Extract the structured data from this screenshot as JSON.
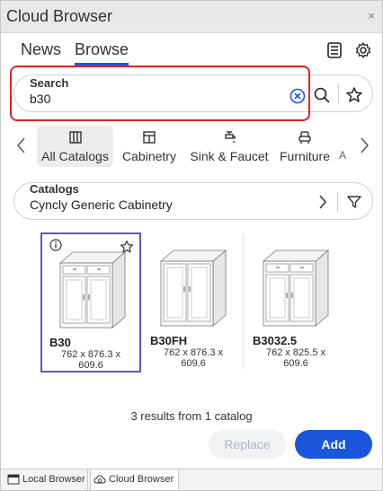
{
  "window": {
    "title": "Cloud Browser",
    "close_glyph": "×"
  },
  "tabs": [
    {
      "label": "News",
      "active": false
    },
    {
      "label": "Browse",
      "active": true
    }
  ],
  "header_icons": [
    "list-view-icon",
    "gear-icon"
  ],
  "search": {
    "label": "Search",
    "value": "b30",
    "icons": [
      "clear-icon",
      "search-icon",
      "star-icon"
    ]
  },
  "categories": [
    {
      "label": "All Catalogs",
      "icon": "catalog-book-icon",
      "active": true
    },
    {
      "label": "Cabinetry",
      "icon": "cabinet-icon",
      "active": false
    },
    {
      "label": "Sink & Faucet",
      "icon": "faucet-icon",
      "active": false
    },
    {
      "label": "Furniture",
      "icon": "armchair-icon",
      "active": false
    },
    {
      "label": "A",
      "icon": "",
      "active": false
    }
  ],
  "catalog": {
    "label": "Catalogs",
    "value": "Cyncly Generic Cabinetry",
    "icons": [
      "chevron-right-icon",
      "filter-icon"
    ]
  },
  "results": [
    {
      "name": "B30",
      "dims_line1": "762 x  876.3 x",
      "dims_line2": "609.6",
      "selected": true,
      "drawers": 2
    },
    {
      "name": "B30FH",
      "dims_line1": "762 x  876.3 x",
      "dims_line2": "609.6",
      "selected": false,
      "drawers": 0
    },
    {
      "name": "B3032.5",
      "dims_line1": "762 x  825.5 x",
      "dims_line2": "609.6",
      "selected": false,
      "drawers": 2
    }
  ],
  "summary": "3 results from 1 catalog",
  "buttons": {
    "replace": "Replace",
    "add": "Add"
  },
  "bottom_tabs": [
    {
      "label": "Local Browser",
      "icon": "local-browser-icon",
      "active": false
    },
    {
      "label": "Cloud Browser",
      "icon": "cloud-browser-icon",
      "active": true
    }
  ],
  "colors": {
    "accent": "#1a56db",
    "highlight": "#e0212b",
    "selection": "#6b4fc7"
  }
}
